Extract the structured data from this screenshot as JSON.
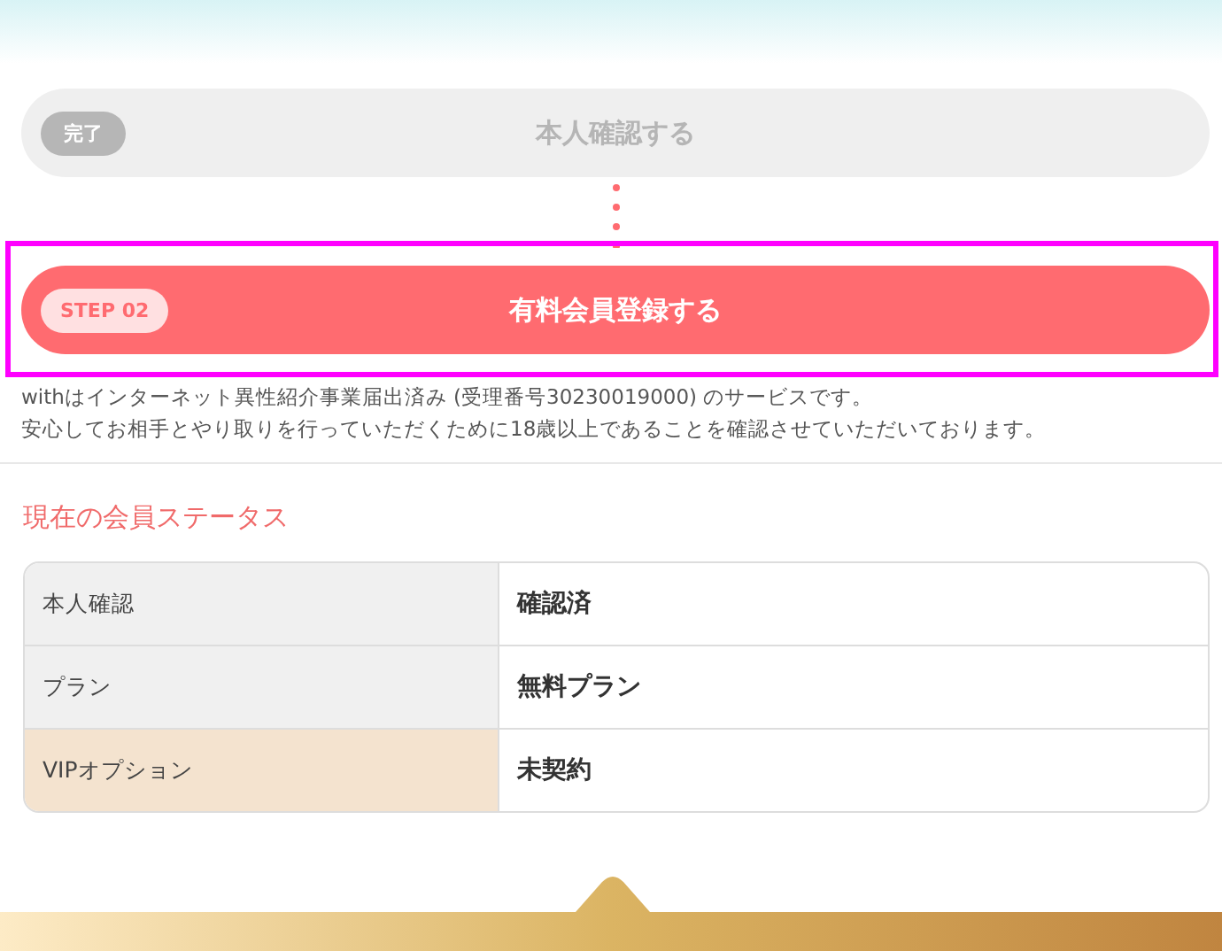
{
  "steps": [
    {
      "kind": "done",
      "badge": "完了",
      "label": "本人確認する"
    },
    {
      "kind": "current",
      "badge": "STEP 02",
      "label": "有料会員登録する"
    }
  ],
  "notice": [
    "withはインターネット異性紹介事業届出済み (受理番号30230019000) のサービスです。",
    "安心してお相手とやり取りを行っていただくために18歳以上であることを確認させていただいております。"
  ],
  "status": {
    "heading": "現在の会員ステータス",
    "rows": [
      {
        "kind": "plain",
        "label": "本人確認",
        "value": "確認済"
      },
      {
        "kind": "plain",
        "label": "プラン",
        "value": "無料プラン"
      },
      {
        "kind": "vip",
        "label": "VIPオプション",
        "value": "未契約"
      }
    ]
  }
}
